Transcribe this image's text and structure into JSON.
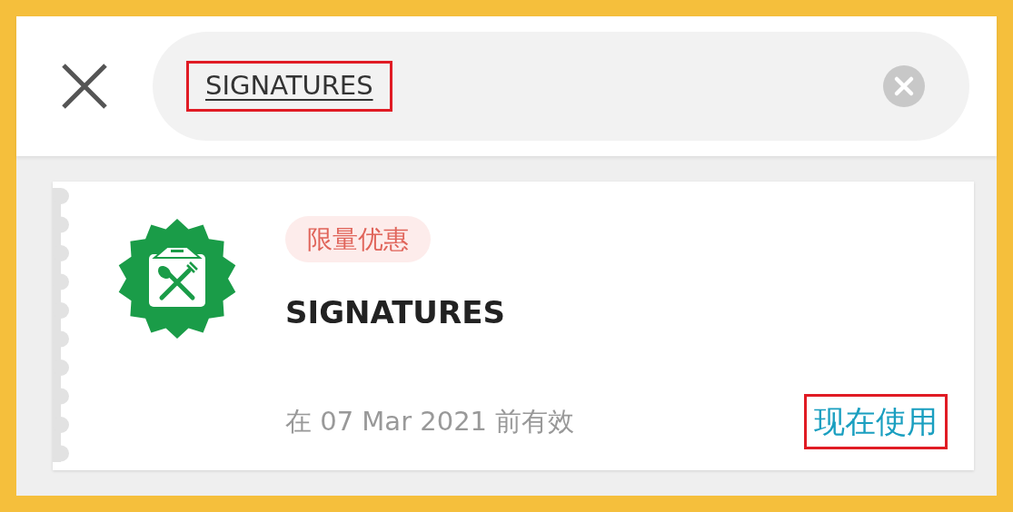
{
  "search": {
    "value": "SIGNATURES",
    "highlighted": true
  },
  "vouchers": [
    {
      "tag": "限量优惠",
      "title": "SIGNATURES",
      "expiry": "在 07 Mar 2021 前有效",
      "action": "现在使用",
      "action_highlighted": true
    }
  ]
}
